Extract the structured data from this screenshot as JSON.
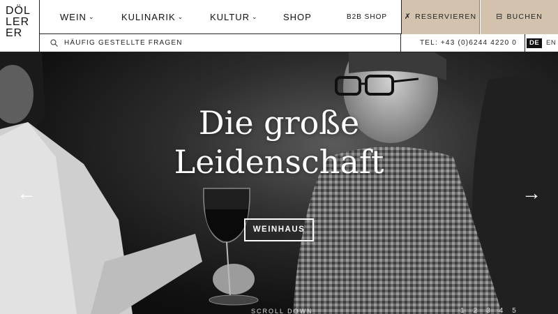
{
  "logo": {
    "lines": [
      "DÖL",
      "LER",
      "ER"
    ]
  },
  "nav": {
    "items": [
      {
        "label": "WEIN"
      },
      {
        "label": "KULINARIK"
      },
      {
        "label": "KULTUR"
      },
      {
        "label": "SHOP"
      },
      {
        "label": "B2B SHOP"
      }
    ],
    "reserve_label": "RESERVIEREN",
    "book_label": "BUCHEN"
  },
  "subbar": {
    "faq_label": "HÄUFIG GESTELLTE FRAGEN",
    "phone": "TEL: +43 (0)6244 4220 0",
    "languages": [
      "DE",
      "EN"
    ],
    "active_language": "DE"
  },
  "hero": {
    "title_line1": "Die große",
    "title_line2": "Leidenschaft",
    "button_label": "WEINHAUS",
    "prev_arrow": "←",
    "next_arrow": "→",
    "scroll_label": "SCROLL DOWN",
    "pages": [
      "1",
      "2",
      "3",
      "4",
      "5"
    ]
  },
  "colors": {
    "accent": "#d3c3ae",
    "border": "#222222"
  },
  "icons": {
    "reserve": "cutlery-icon",
    "book": "bed-icon",
    "faq": "search-icon"
  }
}
